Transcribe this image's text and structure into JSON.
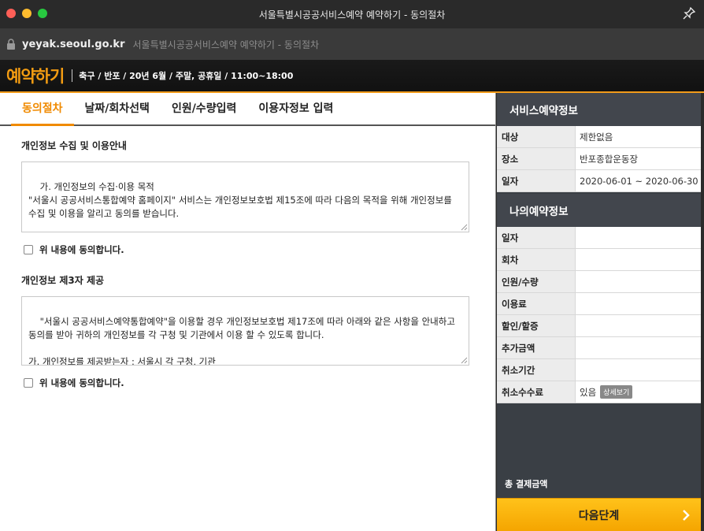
{
  "window": {
    "title": "서울특별시공공서비스예약 예약하기 - 동의절차"
  },
  "urlbar": {
    "domain": "yeyak.seoul.go.kr",
    "page_title": "서울특별시공공서비스예약 예약하기 - 동의절차"
  },
  "header": {
    "logo": "예약하기",
    "info": "축구 / 반포 / 20년 6월 / 주말, 공휴일 / 11:00~18:00"
  },
  "tabs": [
    {
      "label": "동의절차",
      "active": true
    },
    {
      "label": "날짜/회차선택",
      "active": false
    },
    {
      "label": "인원/수량입력",
      "active": false
    },
    {
      "label": "이용자정보 입력",
      "active": false
    }
  ],
  "section1": {
    "title": "개인정보 수집 및 이용안내",
    "text": "가. 개인정보의 수집·이용 목적\n\"서울시 공공서비스통합예약 홈페이지\" 서비스는 개인정보보호법 제15조에 따라 다음의 목적을 위해 개인정보를 수집 및 이용을 알리고 동의를 받습니다.\n\n○ 예약신청서에 입력하시는 정보는 예약 접수 처리와 예약정보 안내를 위한 목적으로 수집 및 이용됩니다.\n○ 또한 서비스 통계 및 만족도 조사 등의 정책 활용 등을 목적으로 개인정보를 이용할 수 있습니다.",
    "agree_label": "위 내용에 동의합니다."
  },
  "section2": {
    "title": "개인정보 제3자 제공",
    "text": "\"서울시 공공서비스예약통합예약\"을 이용할 경우 개인정보보호법 제17조에 따라 아래와 같은 사항을 안내하고 동의를 받아 귀하의 개인정보를 각 구청 및 기관에서 이용 할 수 있도록 합니다.\n\n가. 개인정보를 제공받는자 : 서울시 각 구청, 기관\n\n나. 개인정보를 제공받는 자의 이용 목적",
    "agree_label": "위 내용에 동의합니다."
  },
  "service_info": {
    "heading": "서비스예약정보",
    "rows": [
      {
        "label": "대상",
        "value": "제한없음"
      },
      {
        "label": "장소",
        "value": "반포종합운동장"
      },
      {
        "label": "일자",
        "value": "2020-06-01 ~ 2020-06-30"
      }
    ]
  },
  "my_info": {
    "heading": "나의예약정보",
    "rows": [
      {
        "label": "일자",
        "value": ""
      },
      {
        "label": "회차",
        "value": ""
      },
      {
        "label": "인원/수량",
        "value": ""
      },
      {
        "label": "이용료",
        "value": ""
      },
      {
        "label": "할인/할증",
        "value": ""
      },
      {
        "label": "추가금액",
        "value": ""
      },
      {
        "label": "취소기간",
        "value": ""
      },
      {
        "label": "취소수수료",
        "value": "있음",
        "badge": "상세보기"
      }
    ]
  },
  "total": {
    "label": "총 결제금액"
  },
  "next_button": {
    "label": "다음단계"
  },
  "colors": {
    "accent": "#f08a00",
    "button": "#ffb400",
    "sidebar_bg": "#3a3f45"
  }
}
